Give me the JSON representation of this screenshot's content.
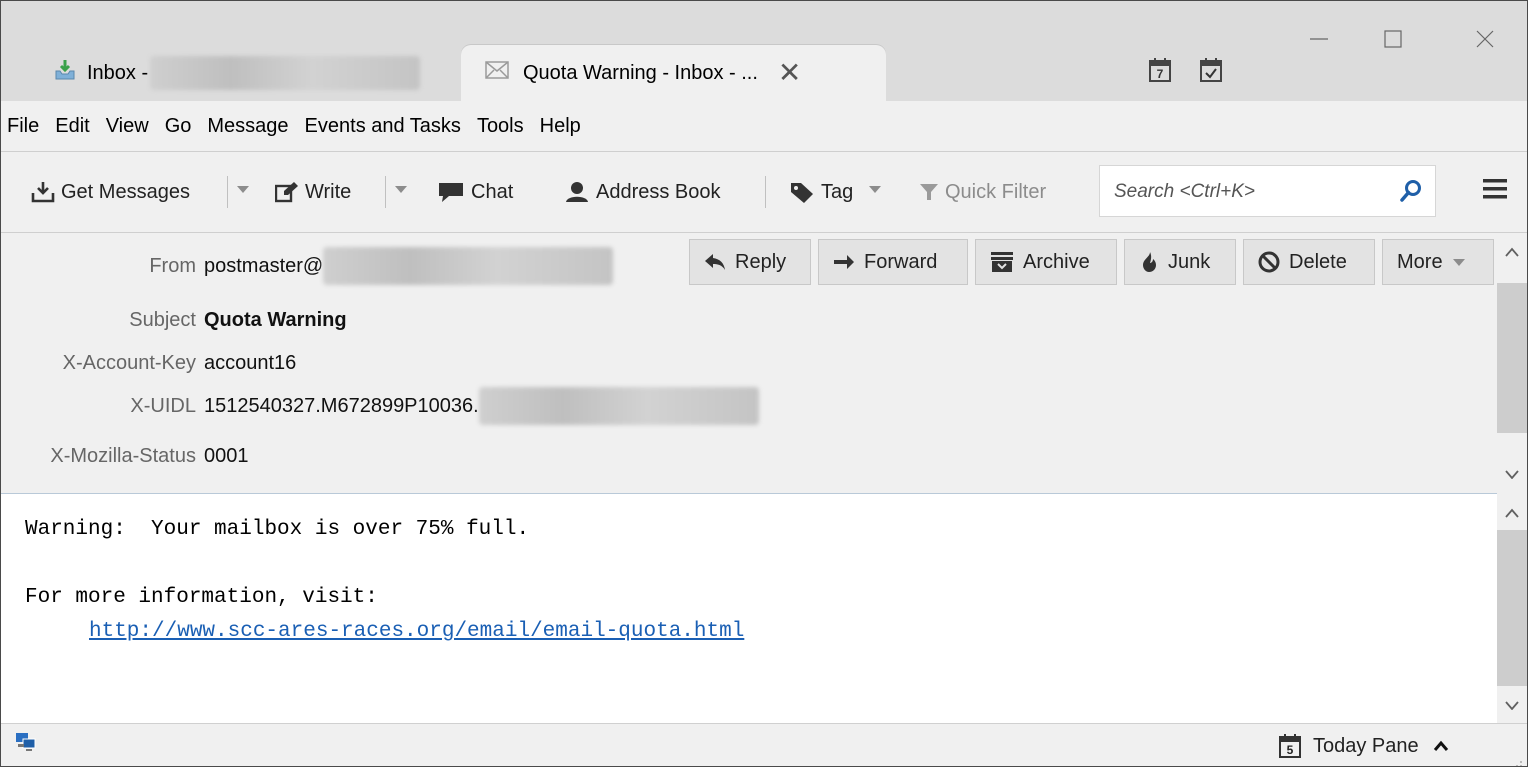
{
  "tabs": {
    "inbox_label": "Inbox -",
    "active_label": "Quota Warning - Inbox - ...",
    "close_glyph": "✕"
  },
  "menu": [
    "File",
    "Edit",
    "View",
    "Go",
    "Message",
    "Events and Tasks",
    "Tools",
    "Help"
  ],
  "toolbar": {
    "get_messages": "Get Messages",
    "write": "Write",
    "chat": "Chat",
    "address_book": "Address Book",
    "tag": "Tag",
    "quick_filter": "Quick Filter",
    "search_placeholder": "Search <Ctrl+K>"
  },
  "header": {
    "fields": [
      {
        "label": "From",
        "value": "postmaster@"
      },
      {
        "label": "Subject",
        "value": "Quota Warning"
      },
      {
        "label": "X-Account-Key",
        "value": "account16"
      },
      {
        "label": "X-UIDL",
        "value": "1512540327.M672899P10036."
      },
      {
        "label": "X-Mozilla-Status",
        "value": "0001"
      }
    ],
    "actions": {
      "reply": "Reply",
      "forward": "Forward",
      "archive": "Archive",
      "junk": "Junk",
      "delete": "Delete",
      "more": "More"
    }
  },
  "body": {
    "line1": "Warning:  Your mailbox is over 75% full.",
    "line2": "For more information, visit:",
    "link": "http://www.scc-ares-races.org/email/email-quota.html"
  },
  "status": {
    "today_pane": "Today Pane",
    "today_day": "5"
  },
  "icons": {
    "calendar_day": "7"
  },
  "colors": {
    "link": "#1a5fb4",
    "accent_blue": "#1f5fa8",
    "titlebar": "#dcdcdc"
  }
}
